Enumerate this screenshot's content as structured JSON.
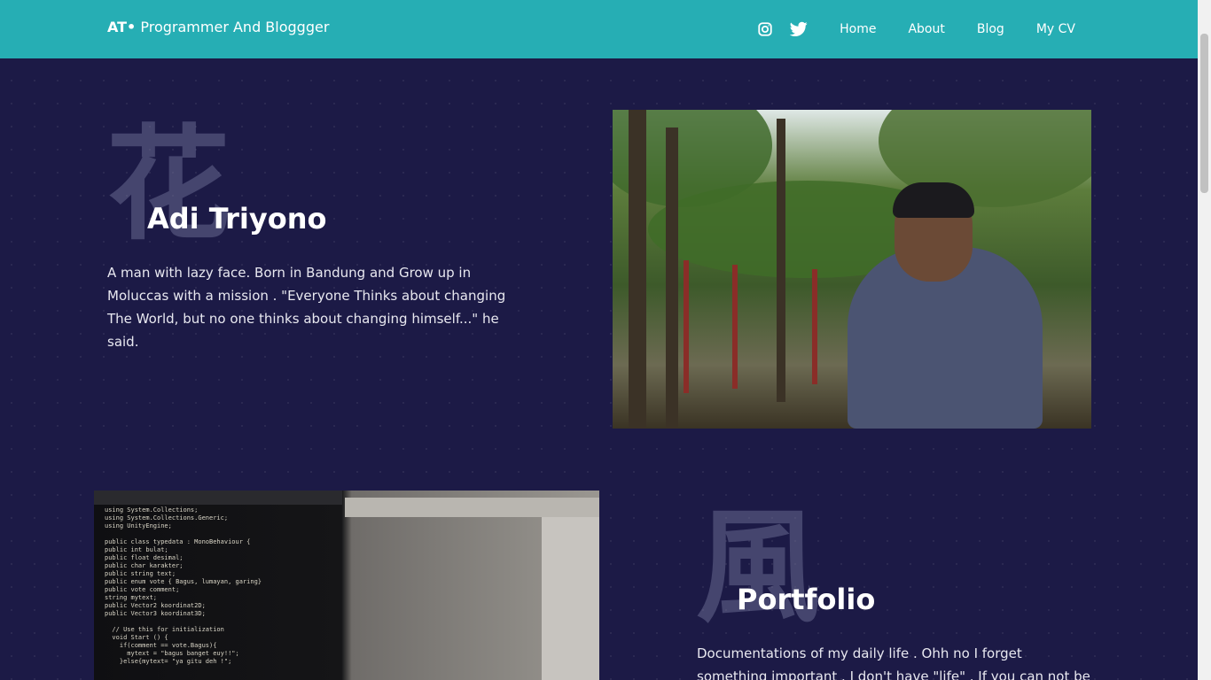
{
  "nav": {
    "brand_strong": "AT•",
    "brand_text": "Programmer And Bloggger",
    "icons": [
      "instagram-icon",
      "twitter-icon"
    ],
    "links": [
      "Home",
      "About",
      "Blog",
      "My CV"
    ]
  },
  "about": {
    "kanji": "花",
    "name": "Adi Triyono",
    "bio": "A man with lazy face. Born in Bandung and Grow up in Moluccas with a mission . \"Everyone Thinks about changing The World, but no one thinks about changing himself...\" he said."
  },
  "portfolio": {
    "kanji": "風",
    "title": "Portfolio",
    "text": "Documentations of my daily life . Ohh no I forget something important . I don't have \"life\" . If you can not be intelligent, just be"
  },
  "colors": {
    "navbar": "#26aeb4",
    "background": "#1c1a46"
  }
}
